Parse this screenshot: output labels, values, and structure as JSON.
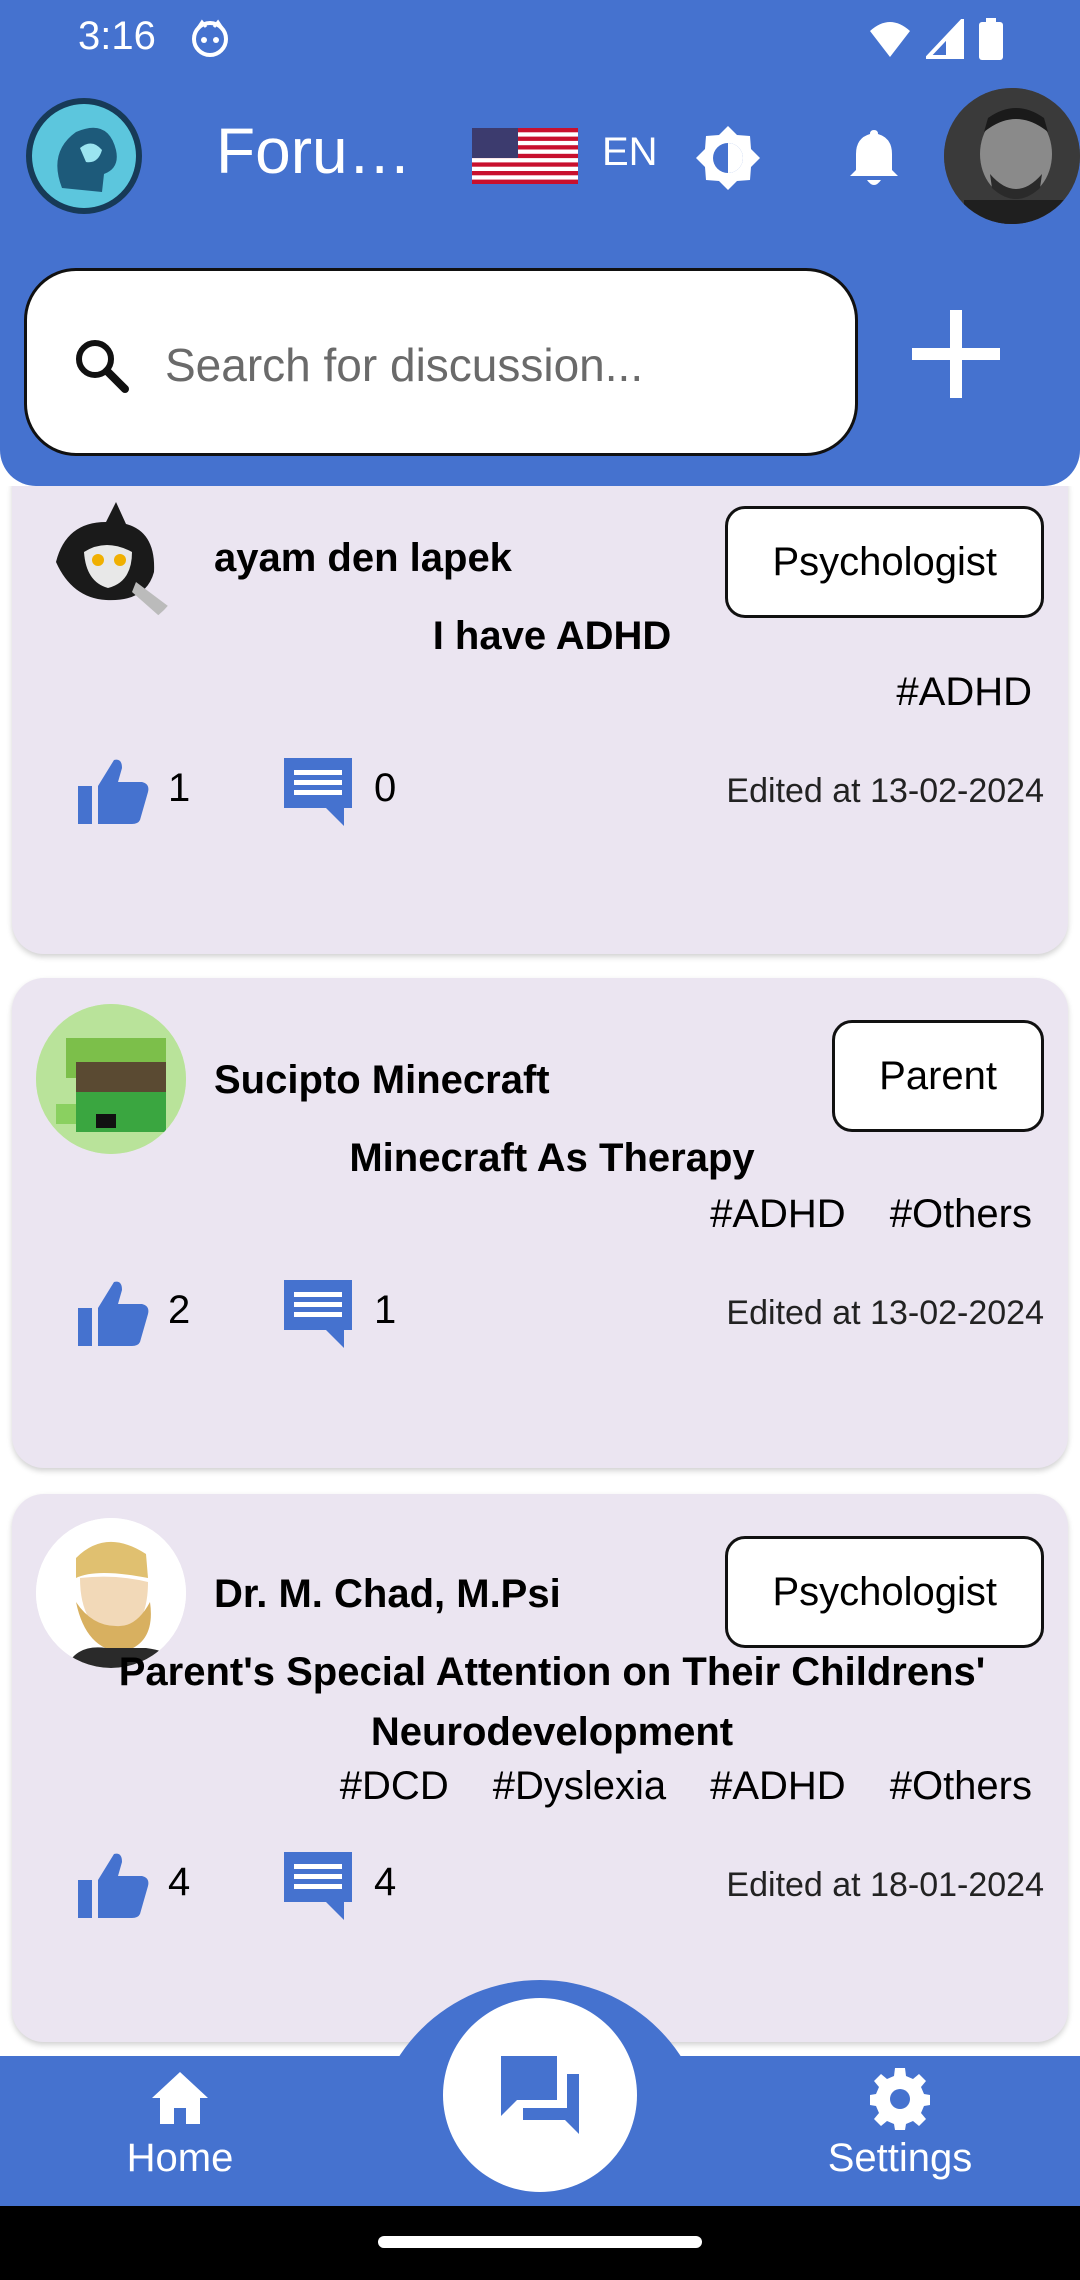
{
  "status_bar": {
    "time": "3:16"
  },
  "app_bar": {
    "title": "Foru…",
    "language": "EN"
  },
  "search": {
    "placeholder": "Search for discussion..."
  },
  "posts": [
    {
      "author": "ayam den lapek",
      "role": "Psychologist",
      "title": "I have ADHD",
      "tags": [
        "#ADHD"
      ],
      "likes": "1",
      "comments": "0",
      "edited": "Edited at 13-02-2024"
    },
    {
      "author": "Sucipto Minecraft",
      "role": "Parent",
      "title": "Minecraft As Therapy",
      "tags": [
        "#ADHD",
        "#Others"
      ],
      "likes": "2",
      "comments": "1",
      "edited": "Edited at 13-02-2024"
    },
    {
      "author": "Dr. M. Chad, M.Psi",
      "role": "Psychologist",
      "title": "Parent's Special Attention on Their Childrens' Neurodevelopment",
      "tags": [
        "#DCD",
        "#Dyslexia",
        "#ADHD",
        "#Others"
      ],
      "likes": "4",
      "comments": "4",
      "edited": "Edited at 18-01-2024"
    }
  ],
  "bottom_nav": {
    "home_label": "Home",
    "settings_label": "Settings"
  },
  "colors": {
    "primary": "#4572cf",
    "card_background": "#ebe5f1"
  }
}
